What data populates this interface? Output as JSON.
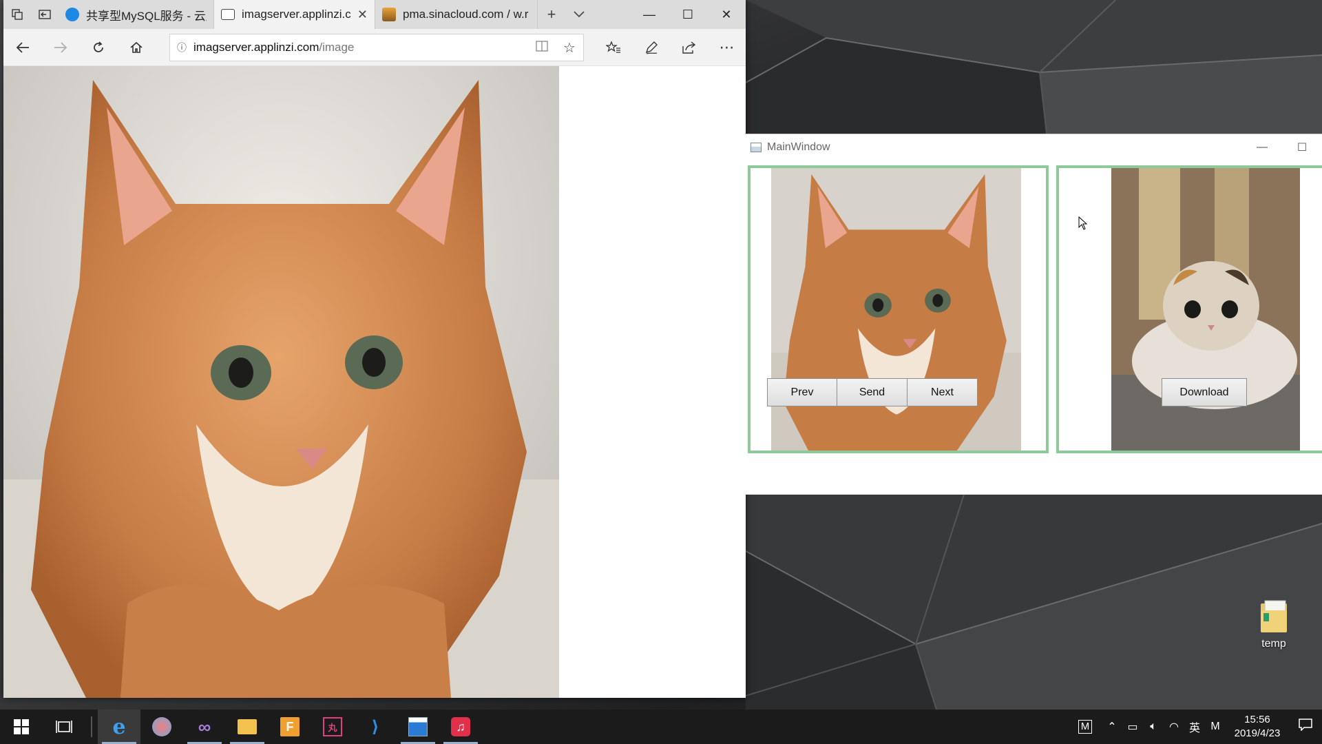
{
  "browser": {
    "tabs": [
      {
        "label": "共享型MySQL服务 - 云应",
        "active": false
      },
      {
        "label": "imagserver.applinzi.c",
        "active": true
      },
      {
        "label": "pma.sinacloud.com / w.r",
        "active": false
      }
    ],
    "url": {
      "host": "imagserver.applinzi.com",
      "path": "/image"
    }
  },
  "main_window": {
    "title": "MainWindow",
    "buttons": {
      "prev": "Prev",
      "send": "Send",
      "next": "Next",
      "download": "Download"
    }
  },
  "desktop": {
    "icon_label": "temp"
  },
  "taskbar": {
    "tray_ime_lang": "英",
    "tray_ime_mode": "M",
    "tray_m": "M",
    "time": "15:56",
    "date": "2019/4/23"
  },
  "colors": {
    "frame_accent": "#8fc89a",
    "taskbar_bg": "#1b1b1b"
  }
}
